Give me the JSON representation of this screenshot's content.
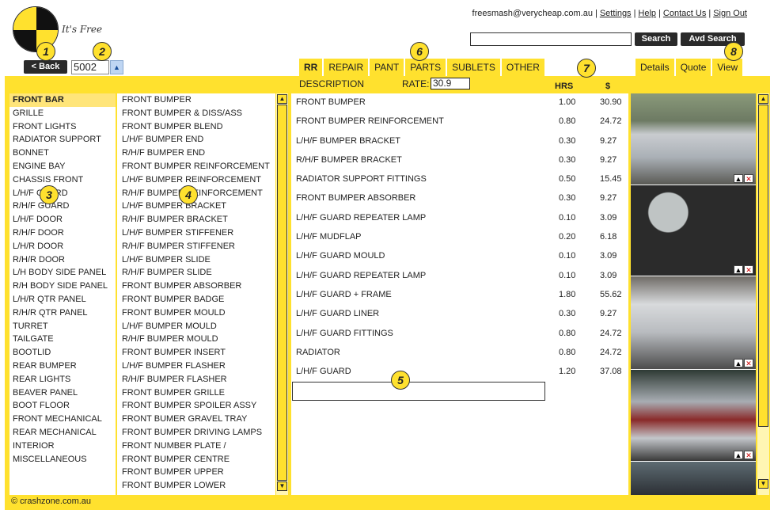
{
  "app": {
    "tagline": "It's Free",
    "footer": "© crashzone.com.au"
  },
  "top_links": {
    "email": "freesmash@verycheap.com.au",
    "settings": "Settings",
    "help": "Help",
    "contact": "Contact Us",
    "signout": "Sign Out"
  },
  "search": {
    "value": "",
    "search_label": "Search",
    "adv_label": "Avd Search"
  },
  "nav": {
    "back_label": "< Back",
    "job_id": "5002",
    "up_icon": "▲"
  },
  "badges": [
    "1",
    "2",
    "3",
    "4",
    "5",
    "6",
    "7",
    "8"
  ],
  "tabs": [
    {
      "label": "RR",
      "active": true
    },
    {
      "label": "REPAIR",
      "active": false
    },
    {
      "label": "PANT",
      "active": false
    },
    {
      "label": "PARTS",
      "active": false
    },
    {
      "label": "SUBLETS",
      "active": false
    },
    {
      "label": "OTHER",
      "active": false
    }
  ],
  "right_tabs": [
    {
      "label": "Details"
    },
    {
      "label": "Quote"
    },
    {
      "label": "View"
    }
  ],
  "header": {
    "description": "DESCRIPTION",
    "rate_label": "RATE:",
    "rate_value": "30.9",
    "hrs": "HRS",
    "dollar": "$"
  },
  "categories": [
    "FRONT BAR",
    "GRILLE",
    "FRONT LIGHTS",
    "RADIATOR SUPPORT",
    "BONNET",
    "ENGINE BAY",
    "CHASSIS FRONT",
    "L/H/F GUARD",
    "R/H/F GUARD",
    "L/H/F DOOR",
    "R/H/F DOOR",
    "L/H/R DOOR",
    "R/H/R DOOR",
    "L/H BODY SIDE PANEL",
    "R/H BODY SIDE PANEL",
    "L/H/R QTR PANEL",
    "R/H/R QTR PANEL",
    "TURRET",
    "TAILGATE",
    "BOOTLID",
    "REAR BUMPER",
    "REAR LIGHTS",
    "BEAVER PANEL",
    "BOOT FLOOR",
    "FRONT MECHANICAL",
    "REAR MECHANICAL",
    "INTERIOR",
    "MISCELLANEOUS"
  ],
  "parts": [
    "FRONT BUMPER",
    "FRONT BUMPER & DISS/ASS",
    "FRONT BUMPER BLEND",
    "L/H/F BUMPER END",
    "R/H/F BUMPER END",
    "FRONT BUMPER REINFORCEMENT",
    "L/H/F BUMPER REINFORCEMENT",
    "R/H/F BUMPER REINFORCEMENT",
    "L/H/F BUMPER BRACKET",
    "R/H/F BUMPER BRACKET",
    "L/H/F BUMPER STIFFENER",
    "R/H/F BUMPER STIFFENER",
    "L/H/F BUMPER SLIDE",
    "R/H/F BUMPER SLIDE",
    "FRONT BUMPER ABSORBER",
    "FRONT BUMPER BADGE",
    "FRONT BUMPER MOULD",
    "L/H/F BUMPER MOULD",
    "R/H/F BUMPER MOULD",
    "FRONT BUMPER INSERT",
    "L/H/F BUMPER FLASHER",
    "R/H/F BUMPER FLASHER",
    "FRONT BUMPER GRILLE",
    "FRONT BUMPER SPOILER ASSY",
    "FRONT BUMER GRAVEL TRAY",
    "FRONT BUMPER DRIVING LAMPS",
    "FRONT NUMBER PLATE /",
    "FRONT BUMPER CENTRE",
    "FRONT BUMPER UPPER",
    "FRONT BUMPER LOWER"
  ],
  "rows": [
    {
      "desc": "FRONT BUMPER",
      "hrs": "1.00",
      "amt": "30.90"
    },
    {
      "desc": "FRONT BUMPER REINFORCEMENT",
      "hrs": "0.80",
      "amt": "24.72"
    },
    {
      "desc": "L/H/F BUMPER BRACKET",
      "hrs": "0.30",
      "amt": "9.27"
    },
    {
      "desc": "R/H/F BUMPER BRACKET",
      "hrs": "0.30",
      "amt": "9.27"
    },
    {
      "desc": "RADIATOR SUPPORT FITTINGS",
      "hrs": "0.50",
      "amt": "15.45"
    },
    {
      "desc": "FRONT BUMPER ABSORBER",
      "hrs": "0.30",
      "amt": "9.27"
    },
    {
      "desc": "L/H/F GUARD REPEATER LAMP",
      "hrs": "0.10",
      "amt": "3.09"
    },
    {
      "desc": "L/H/F MUDFLAP",
      "hrs": "0.20",
      "amt": "6.18"
    },
    {
      "desc": "L/H/F GUARD MOULD",
      "hrs": "0.10",
      "amt": "3.09"
    },
    {
      "desc": "L/H/F GUARD REPEATER LAMP",
      "hrs": "0.10",
      "amt": "3.09"
    },
    {
      "desc": "L/H/F GUARD + FRAME",
      "hrs": "1.80",
      "amt": "55.62"
    },
    {
      "desc": "L/H/F GUARD LINER",
      "hrs": "0.30",
      "amt": "9.27"
    },
    {
      "desc": "L/H/F GUARD FITTINGS",
      "hrs": "0.80",
      "amt": "24.72"
    },
    {
      "desc": "RADIATOR",
      "hrs": "0.80",
      "amt": "24.72"
    },
    {
      "desc": "L/H/F GUARD",
      "hrs": "1.20",
      "amt": "37.08"
    }
  ],
  "photos": [
    {
      "icon": "car-photo-silver-front"
    },
    {
      "icon": "dashboard-photo"
    },
    {
      "icon": "car-photo-rear"
    },
    {
      "icon": "car-photo-damaged-rear"
    },
    {
      "icon": "car-photo-partial"
    }
  ],
  "colors": {
    "accent": "#ffe12e",
    "dark": "#2a2a2a"
  }
}
